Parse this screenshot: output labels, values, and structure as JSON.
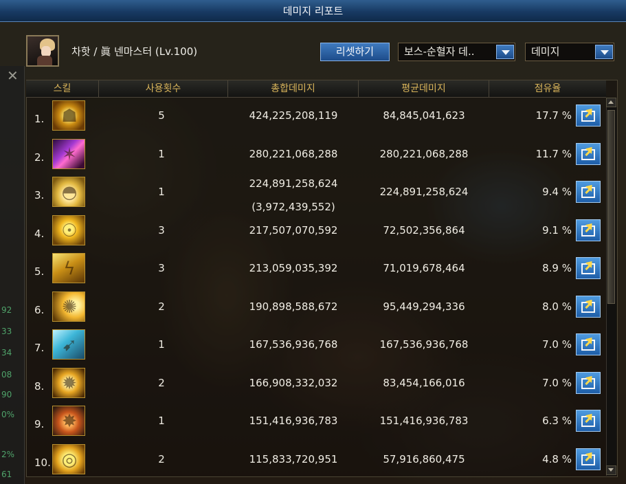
{
  "window": {
    "title": "데미지 리포트"
  },
  "header": {
    "character_name": "차핫 / 眞 넨마스터 (Lv.100)",
    "reset_button": "리셋하기",
    "boss_select": "보스-순혈자 데..",
    "type_select": "데미지"
  },
  "table": {
    "columns": [
      "스킬",
      "사용횟수",
      "총합데미지",
      "평균데미지",
      "점유율"
    ],
    "rows": [
      {
        "rank": "1.",
        "icon": "roar-skill-icon",
        "count": "5",
        "total": "424,225,208,119",
        "total_sub": "",
        "average": "84,845,041,623",
        "share": "17.7 %"
      },
      {
        "rank": "2.",
        "icon": "dark-dragon-skill-icon",
        "count": "1",
        "total": "280,221,068,288",
        "total_sub": "",
        "average": "280,221,068,288",
        "share": "11.7 %"
      },
      {
        "rank": "3.",
        "icon": "dome-skill-icon",
        "count": "1",
        "total": "224,891,258,624",
        "total_sub": "(3,972,439,552)",
        "average": "224,891,258,624",
        "share": "9.4 %"
      },
      {
        "rank": "4.",
        "icon": "aura-body-skill-icon",
        "count": "3",
        "total": "217,507,070,592",
        "total_sub": "",
        "average": "72,502,356,864",
        "share": "9.1 %"
      },
      {
        "rank": "5.",
        "icon": "lightning-dragon-skill-icon",
        "count": "3",
        "total": "213,059,035,392",
        "total_sub": "",
        "average": "71,019,678,464",
        "share": "8.9 %"
      },
      {
        "rank": "6.",
        "icon": "blast-skill-icon",
        "count": "2",
        "total": "190,898,588,672",
        "total_sub": "",
        "average": "95,449,294,336",
        "share": "8.0 %"
      },
      {
        "rank": "7.",
        "icon": "kick-skill-icon",
        "count": "1",
        "total": "167,536,936,768",
        "total_sub": "",
        "average": "167,536,936,768",
        "share": "7.0 %"
      },
      {
        "rank": "8.",
        "icon": "burst-skill-icon",
        "count": "2",
        "total": "166,908,332,032",
        "total_sub": "",
        "average": "83,454,166,016",
        "share": "7.0 %"
      },
      {
        "rank": "9.",
        "icon": "explosion-skill-icon",
        "count": "1",
        "total": "151,416,936,783",
        "total_sub": "",
        "average": "151,416,936,783",
        "share": "6.3 %"
      },
      {
        "rank": "10.",
        "icon": "orb-skill-icon",
        "count": "2",
        "total": "115,833,720,951",
        "total_sub": "",
        "average": "57,916,860,475",
        "share": "4.8 %"
      }
    ]
  },
  "left_panel": {
    "numbers": [
      "92",
      "33",
      "34",
      "08",
      "90",
      "0%",
      "2%",
      "61"
    ]
  },
  "colors": {
    "header_text": "#d9b45a",
    "title_bar": "#1d4c8a",
    "accent_button": "#3f7bc0"
  }
}
